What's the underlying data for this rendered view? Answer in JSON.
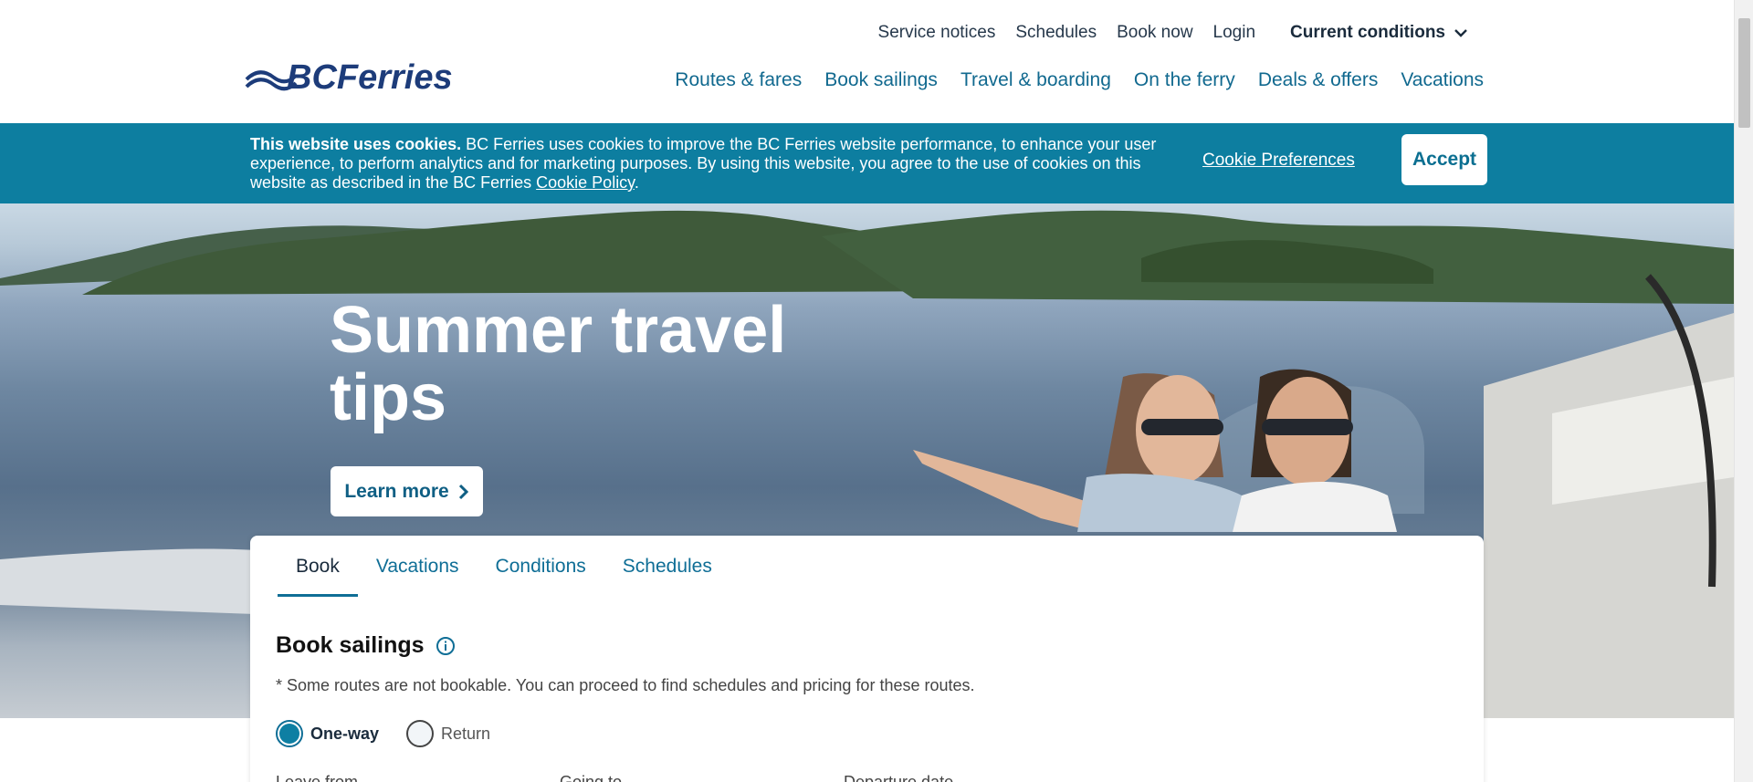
{
  "header": {
    "logo_alt": "BCFerries",
    "utility_nav": [
      "Service notices",
      "Schedules",
      "Book now",
      "Login"
    ],
    "current_conditions": "Current conditions",
    "main_nav": [
      "Routes & fares",
      "Book sailings",
      "Travel & boarding",
      "On the ferry",
      "Deals & offers",
      "Vacations"
    ]
  },
  "cookie": {
    "lead": "This website uses cookies.",
    "body": " BC Ferries uses cookies to improve the BC Ferries website performance, to enhance your user experience, to perform analytics and for marketing purposes. By using this website, you agree to the use of cookies on this website as described in the BC Ferries ",
    "policy_link": "Cookie Policy",
    "tail": ".",
    "preferences": "Cookie Preferences",
    "accept": "Accept"
  },
  "hero": {
    "title": "Summer travel tips",
    "cta": "Learn more"
  },
  "booking": {
    "tabs": [
      "Book",
      "Vacations",
      "Conditions",
      "Schedules"
    ],
    "active_tab": "Book",
    "title": "Book sailings",
    "note": "* Some routes are not bookable. You can proceed to find schedules and pricing for these routes.",
    "trip_types": [
      "One-way",
      "Return"
    ],
    "selected_trip_type": "One-way",
    "field_labels": [
      "Leave from",
      "Going to",
      "Departure date"
    ]
  },
  "colors": {
    "brand_blue": "#0d7ea0",
    "link_blue": "#11698f",
    "dark_navy": "#1a2b3c"
  }
}
